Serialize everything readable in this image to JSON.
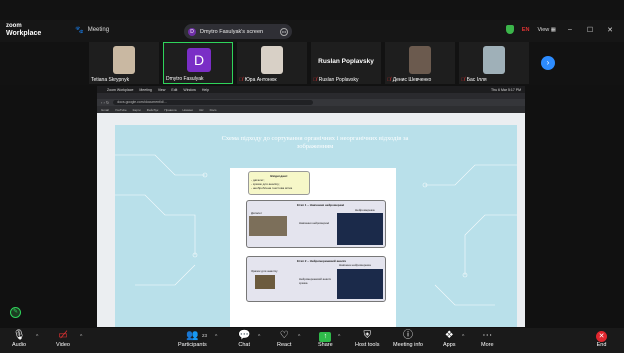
{
  "app": {
    "logo_line1": "zoom",
    "logo_line2": "Workplace",
    "meeting_label": "Meeting"
  },
  "share_banner": {
    "initial": "D",
    "text": "Dmytro Fasulyak's screen"
  },
  "titlebar_right": {
    "lang": "EN",
    "view": "View"
  },
  "participants": [
    {
      "name": "Tetiana Skrypnyk",
      "muted": false,
      "face_color": "#c9b8a2"
    },
    {
      "name": "Dmytro Fasulyak",
      "muted": false,
      "initial": "D",
      "active": true
    },
    {
      "name": "Юра Антонюк",
      "muted": true,
      "face_color": "#d8d0c6"
    },
    {
      "name": "Ruslan Poplavsky",
      "muted": true,
      "big_label": "Ruslan Poplavsky"
    },
    {
      "name": "Денис Шевченко",
      "muted": true,
      "face_color": "#6b5a4e"
    },
    {
      "name": "Бас Ілля",
      "muted": true,
      "face_color": "#9fb0b8"
    }
  ],
  "shared_screen": {
    "mac_menu": [
      "Zoom Workplace",
      "Meeting",
      "View",
      "Edit",
      "Window",
      "Help"
    ],
    "mac_clock": "Thu 6 Mar 5:17 PM",
    "url": "docs.google.com/document/d/...",
    "bookmarks": [
      "Gmail",
      "YouTube",
      "Карти",
      "Фейсбук",
      "Правила",
      "Новини",
      "Ukr",
      "Docs"
    ],
    "slide_title": "Схема підходу до сортування органічних і неорганічних відходів за зображенням"
  },
  "toolbar": {
    "audio": "Audio",
    "video": "Video",
    "participants": "Participants",
    "participant_count": "23",
    "chat": "Chat",
    "react": "React",
    "share": "Share",
    "host_tools": "Host tools",
    "meeting_info": "Meeting info",
    "apps": "Apps",
    "more": "More",
    "end": "End"
  },
  "flow": {
    "input_title": "Вхідні дані:",
    "input_1": "- датасет;",
    "input_2": "- зразок для аналізу;",
    "input_3": "- необроблена текстова мітка",
    "stage1": "Етап 1 – Навчання нейромережі",
    "dataset": "Датасет",
    "neuro": "Нейромережа",
    "train": "Навчання нейромережі",
    "stage2": "Етап 2 – Нейромережевий аналіз",
    "sample": "Зразок для аналізу",
    "trained": "Навчена нейромережа",
    "result": "Нейромережевий аналіз зразка"
  }
}
